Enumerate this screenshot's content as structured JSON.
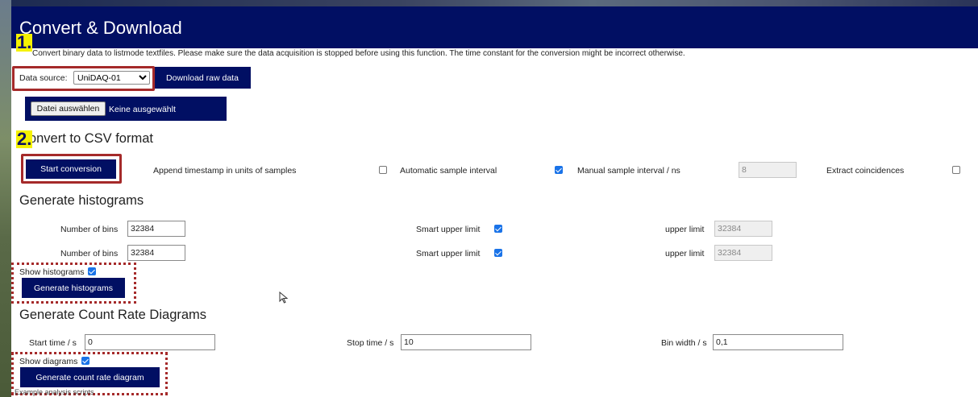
{
  "header": {
    "title": "Convert & Download",
    "description": "Convert binary data to listmode textfiles. Please make sure the data acquisition is stopped before using this function. The time constant for the conversion might be incorrect otherwise."
  },
  "annotations": {
    "step1": "1.",
    "step2": "2.",
    "color_red": "#a52a2a",
    "color_yellow": "#f5f200"
  },
  "download": {
    "source_label": "Data source:",
    "source_value": "UniDAQ-01",
    "download_button": "Download raw data",
    "file_button": "Datei auswählen",
    "file_status": "Keine ausgewählt"
  },
  "csv": {
    "title": "Convert to CSV format",
    "start_button": "Start conversion",
    "append_timestamp_label": "Append timestamp in units of samples",
    "append_timestamp_checked": false,
    "auto_interval_label": "Automatic sample interval",
    "auto_interval_checked": true,
    "manual_interval_label": "Manual sample interval / ns",
    "manual_interval_value": "8",
    "extract_coincidences_label": "Extract coincidences",
    "extract_coincidences_checked": false
  },
  "histograms": {
    "title": "Generate histograms",
    "rows": [
      {
        "bins_label": "Number of bins",
        "bins_value": "32384",
        "smart_label": "Smart upper limit",
        "smart_checked": true,
        "upper_label": "upper limit",
        "upper_value": "32384"
      },
      {
        "bins_label": "Number of bins",
        "bins_value": "32384",
        "smart_label": "Smart upper limit",
        "smart_checked": true,
        "upper_label": "upper limit",
        "upper_value": "32384"
      }
    ],
    "show_label": "Show histograms",
    "show_checked": true,
    "generate_button": "Generate histograms"
  },
  "count_rate": {
    "title": "Generate Count Rate Diagrams",
    "start_label": "Start time / s",
    "start_value": "0",
    "stop_label": "Stop time / s",
    "stop_value": "10",
    "bin_label": "Bin width / s",
    "bin_value": "0,1",
    "show_label": "Show diagrams",
    "show_checked": true,
    "generate_button": "Generate count rate diagram"
  },
  "footer": {
    "partial_text": "Example analysis scripts"
  },
  "colors": {
    "navy": "#010f63",
    "checkbox_blue": "#1a73e8"
  }
}
